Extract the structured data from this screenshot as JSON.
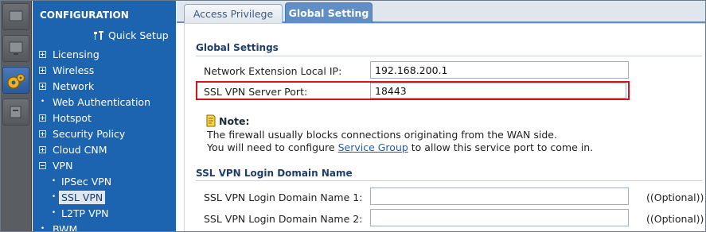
{
  "nav": {
    "header": "CONFIGURATION",
    "quick_setup": "Quick Setup",
    "items": [
      {
        "label": "Licensing",
        "marker": "plus"
      },
      {
        "label": "Wireless",
        "marker": "plus"
      },
      {
        "label": "Network",
        "marker": "plus"
      },
      {
        "label": "Web Authentication",
        "marker": "dot"
      },
      {
        "label": "Hotspot",
        "marker": "plus"
      },
      {
        "label": "Security Policy",
        "marker": "plus"
      },
      {
        "label": "Cloud CNM",
        "marker": "plus"
      },
      {
        "label": "VPN",
        "marker": "minus"
      },
      {
        "label": "IPSec VPN",
        "marker": "dot",
        "sub": true
      },
      {
        "label": "SSL VPN",
        "marker": "dot",
        "sub": true,
        "selected": true
      },
      {
        "label": "L2TP VPN",
        "marker": "dot",
        "sub": true
      },
      {
        "label": "BWM",
        "marker": "dot"
      }
    ]
  },
  "tabs": {
    "access_privilege": "Access Privilege",
    "global_setting": "Global Setting"
  },
  "global_settings": {
    "title": "Global Settings",
    "network_ext_label": "Network Extension Local IP:",
    "network_ext_value": "192.168.200.1",
    "server_port_label": "SSL VPN Server Port:",
    "server_port_value": "18443"
  },
  "note": {
    "title": "Note:",
    "line1": "The firewall usually blocks connections originating from the WAN side.",
    "line2_prefix": "You will need to configure ",
    "line2_link": "Service Group",
    "line2_suffix": " to allow this service port to come in."
  },
  "login_domain": {
    "title": "SSL VPN Login Domain Name",
    "name1_label": "SSL VPN Login Domain Name 1:",
    "name1_value": "",
    "name1_optional": "((Optional))",
    "name2_label": "SSL VPN Login Domain Name 2:",
    "name2_value": "",
    "name2_optional": "((Optional))"
  },
  "colors": {
    "nav_bg": "#1c63b0",
    "active_tab": "#5f8fc6",
    "highlight_border": "#d8121b",
    "link": "#1a5dc0"
  }
}
